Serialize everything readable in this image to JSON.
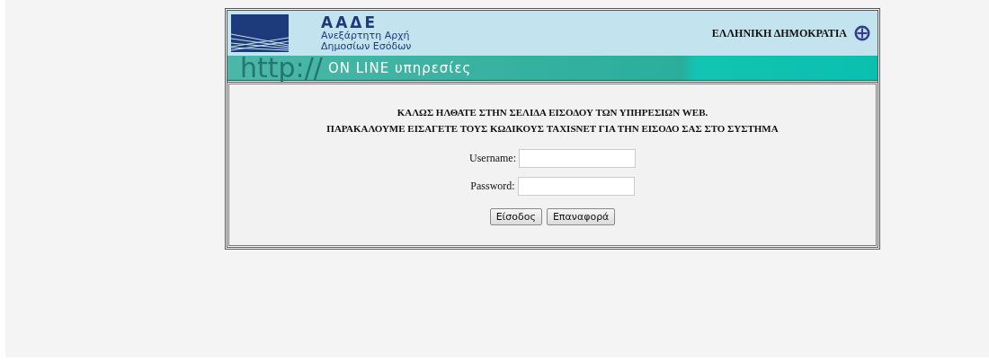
{
  "header": {
    "logo_title": "ΑΑΔΕ",
    "logo_subtitle_lines": [
      "Ανεξάρτητη Αρχή",
      "Δημοσίων Εσόδων"
    ],
    "country": "ΕΛΛΗΝΙΚΗ ΔΗΜΟΚΡΑΤΙΑ",
    "banner_prefix": "http://",
    "banner_text": "ON LINE υπηρεσίες"
  },
  "welcome_lines": [
    "ΚΑΛΩΣ ΗΛΘΑΤΕ ΣΤΗΝ ΣΕΛΙΔΑ ΕΙΣΟΔΟΥ ΤΩΝ ΥΠΗΡΕΣΙΩΝ WEB.",
    "ΠΑΡΑΚΑΛΟΥΜΕ ΕΙΣΑΓΕΤΕ ΤΟΥΣ ΚΩΔΙΚΟΥΣ TAXISNET ΓΙΑ ΤΗΝ ΕΙΣΟΔΟ ΣΑΣ ΣΤΟ ΣΥΣΤΗΜΑ"
  ],
  "fields": [
    {
      "label": "Username:"
    },
    {
      "label": "Password:"
    }
  ],
  "buttons": [
    "Είσοδος",
    "Επαναφορά"
  ]
}
